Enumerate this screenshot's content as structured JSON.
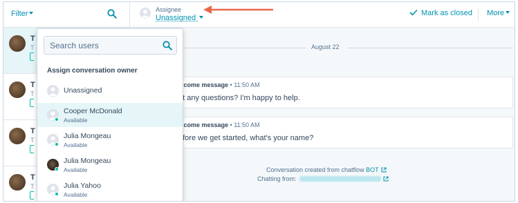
{
  "topbar": {
    "filter_label": "Filter",
    "assignee_label": "Assignee",
    "assignee_value": "Unassigned",
    "mark_closed_label": "Mark as closed",
    "more_label": "More"
  },
  "threads": [
    {
      "initial": "T",
      "sub": "T"
    },
    {
      "initial": "T",
      "sub": "T"
    },
    {
      "initial": "T",
      "sub": "T"
    },
    {
      "initial": "T",
      "sub": "T"
    }
  ],
  "conversation": {
    "date": "August 22",
    "messages": [
      {
        "title": "elcome message",
        "time": "11:50 AM",
        "text": "ot any questions? I'm happy to help."
      },
      {
        "title": "elcome message",
        "time": "11:50 AM",
        "text": "efore we get started, what's your name?"
      }
    ],
    "created_prefix": "Conversation created from chatflow",
    "created_link": "BOT",
    "chatting_from_label": "Chatting from:"
  },
  "dropdown": {
    "search_placeholder": "Search users",
    "heading": "Assign conversation owner",
    "options": [
      {
        "name": "Unassigned",
        "status": "",
        "avatar": "user-icon"
      },
      {
        "name": "Cooper McDonald",
        "status": "Available",
        "avatar": "user-icon"
      },
      {
        "name": "Julia Mongeau",
        "status": "Available",
        "avatar": "user-icon"
      },
      {
        "name": "Julia Mongeau",
        "status": "Available",
        "avatar": "photo"
      },
      {
        "name": "Julia Yahoo",
        "status": "Available",
        "avatar": "user-icon"
      }
    ]
  },
  "colors": {
    "accent": "#0091ae",
    "arrow": "#e8694a",
    "available": "#00bda5",
    "hover": "#e5f5f8"
  }
}
